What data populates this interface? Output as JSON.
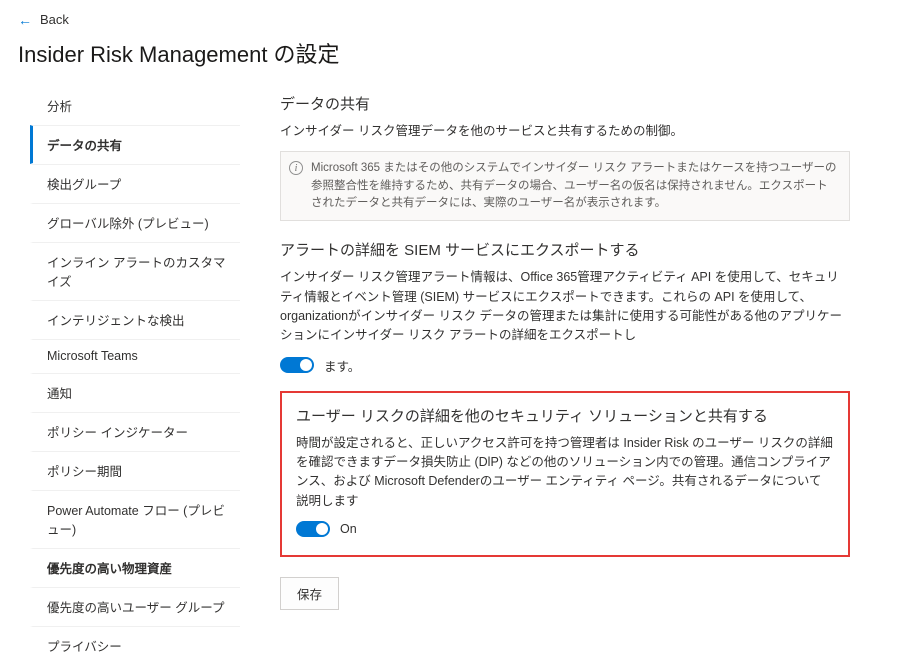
{
  "back": {
    "label": "Back"
  },
  "title": "Insider Risk Management の設定",
  "sidebar": {
    "items": [
      {
        "label": "分析"
      },
      {
        "label": "データの共有"
      },
      {
        "label": "検出グループ"
      },
      {
        "label": "グローバル除外 (プレビュー)"
      },
      {
        "label": "インライン アラートのカスタマイズ"
      },
      {
        "label": "インテリジェントな検出"
      },
      {
        "label": "Microsoft Teams"
      },
      {
        "label": "通知"
      },
      {
        "label": "ポリシー インジケーター"
      },
      {
        "label": "ポリシー期間"
      },
      {
        "label": "Power Automate フロー (プレビュー)"
      },
      {
        "label": "優先度の高い物理資産"
      },
      {
        "label": "優先度の高いユーザー グループ"
      },
      {
        "label": "プライバシー"
      }
    ],
    "selected_index": 1,
    "bold_index": 11
  },
  "section_data_sharing": {
    "title": "データの共有",
    "desc": "インサイダー リスク管理データを他のサービスと共有するための制御。",
    "info": "Microsoft 365 またはその他のシステムでインサイダー リスク アラートまたはケースを持つユーザーの参照整合性を維持するため、共有データの場合、ユーザー名の仮名は保持されません。エクスポートされたデータと共有データには、実際のユーザー名が表示されます。"
  },
  "section_export": {
    "title": "アラートの詳細を SIEM サービスにエクスポートする",
    "desc": "インサイダー リスク管理アラート情報は、Office 365管理アクティビティ API を使用して、セキュリティ情報とイベント管理 (SIEM) サービスにエクスポートできます。これらの API を使用して、organizationがインサイダー リスク データの管理または集計に使用する可能性がある他のアプリケーションにインサイダー リスク アラートの詳細をエクスポートし",
    "toggle_label": "ます。",
    "toggle_on": true
  },
  "section_share_risk": {
    "title": "ユーザー リスクの詳細を他のセキュリティ ソリューションと共有する",
    "desc": "時間が設定されると、正しいアクセス許可を持つ管理者は Insider Risk のユーザー リスクの詳細を確認できますデータ損失防止 (DlP) などの他のソリューション内での管理。通信コンプライアンス、および Microsoft Defenderのユーザー エンティティ ページ。共有されるデータについて説明します",
    "toggle_label": "On",
    "toggle_on": true
  },
  "save_label": "保存",
  "colors": {
    "accent": "#0078d4",
    "highlight": "#e53935"
  }
}
